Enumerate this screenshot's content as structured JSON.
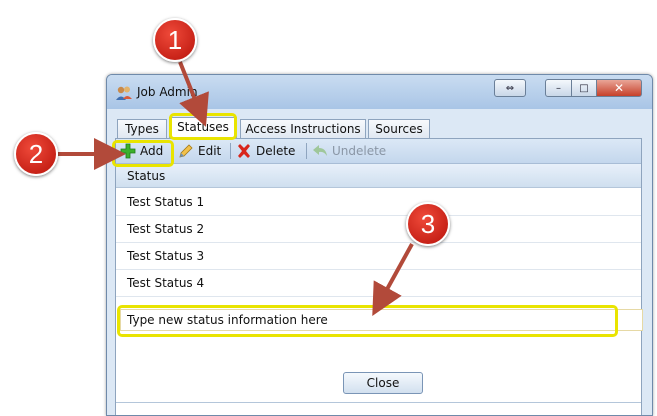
{
  "window": {
    "title": "Job Admin",
    "resize_glyph": "⇔",
    "minimize_glyph": "–",
    "maximize_glyph": "□",
    "close_glyph": "✕"
  },
  "tabs": [
    {
      "label": "Types",
      "active": false
    },
    {
      "label": "Statuses",
      "active": true
    },
    {
      "label": "Access Instructions",
      "active": false
    },
    {
      "label": "Sources",
      "active": false
    }
  ],
  "toolbar": {
    "add_label": "Add",
    "edit_label": "Edit",
    "delete_label": "Delete",
    "undelete_label": "Undelete"
  },
  "grid": {
    "column_header": "Status",
    "rows": [
      "Test Status 1",
      "Test Status 2",
      "Test Status 3",
      "Test Status 4"
    ],
    "new_row_value": "Type new status information here"
  },
  "footer": {
    "close_label": "Close"
  },
  "callouts": [
    "1",
    "2",
    "3"
  ],
  "colors": {
    "highlight": "#e9e400",
    "badge": "#d0261a",
    "arrow": "#b24a3a"
  }
}
